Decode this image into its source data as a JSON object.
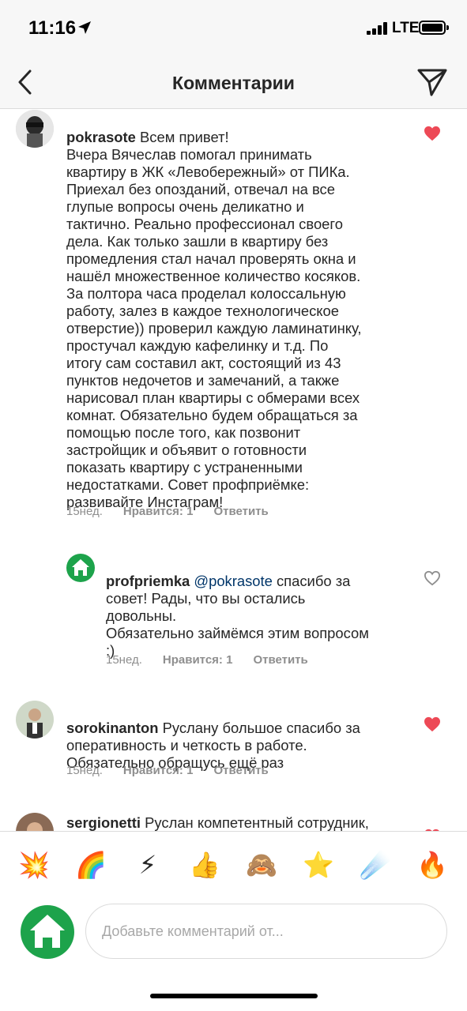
{
  "status_bar": {
    "time": "11:16",
    "network": "LTE"
  },
  "header": {
    "title": "Комментарии",
    "back_icon": "chevron-left-icon",
    "send_icon": "paper-plane-icon"
  },
  "comments": [
    {
      "user": "pokrasote",
      "text": "Всем привет!\nВчера Вячеслав помогал принимать\nквартиру в ЖК «Левобережный» от ПИКа.\nПриехал без опозданий, отвечал на все\nглупые вопросы очень деликатно и\nтактично. Реально профессионал своего\nдела. Как только зашли в квартиру без\nпромедления стал начал проверять окна и\nнашёл множественное количество косяков.\nЗа полтора часа проделал колоссальную\nработу, залез в каждое технологическое\nотверстие)) проверил каждую ламинатинку,\nпростучал каждую кафелинку и т.д. По\nитогу сам составил акт, состоящий из 43\nпунктов недочетов и замечаний, а также\nнарисовал план квартиры с обмерами всех\nкомнат. Обязательно будем обращаться за\nпомощью после того, как позвонит\nзастройщик и объявит о готовности\nпоказать квартиру с устраненными\nнедостатками. Совет профприёмке:\nразвивайте Инстаграм!",
      "time": "15нед.",
      "likes": "Нравится: 1",
      "reply": "Ответить",
      "liked": true
    },
    {
      "user": "profpriemka",
      "mention": "@pokrasote",
      "text": " спасибо за\nсовет! Рады, что вы остались\nдовольны.\nОбязательно займёмся этим вопросом\n:)",
      "time": "15нед.",
      "likes": "Нравится: 1",
      "reply": "Ответить",
      "liked": false
    },
    {
      "user": "sorokinanton",
      "text": "Руслану большое спасибо за\nоперативность и четкость в работе.\nОбязательно обращусь ещё раз",
      "time": "15нед.",
      "likes": "Нравится: 1",
      "reply": "Ответить",
      "liked": true
    },
    {
      "user": "sergionetti",
      "text": "Руслан компетентный сотрудник,",
      "liked": true
    }
  ],
  "emojis": [
    "💥",
    "🌈",
    "⚡",
    "👍",
    "🙈",
    "⭐",
    "☄️",
    "🔥"
  ],
  "composer": {
    "placeholder": "Добавьте комментарий от..."
  },
  "colors": {
    "heart_red": "#ed4956",
    "brand_green": "#1da34b",
    "mention_blue": "#003569"
  }
}
